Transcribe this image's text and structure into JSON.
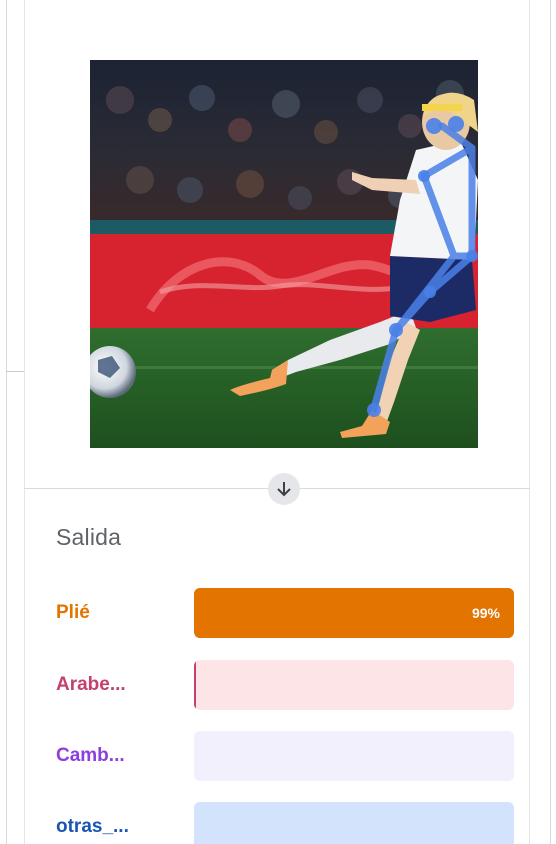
{
  "output": {
    "title": "Salida",
    "rows": [
      {
        "label": "Plié",
        "fraction": 0.99,
        "percent_text": "99%",
        "text_color": "#e37400",
        "fill_color": "#e37400",
        "track_color": "#e37400"
      },
      {
        "label": "Arabe...",
        "fraction": 0.005,
        "percent_text": "",
        "text_color": "#c5416a",
        "fill_color": "#c5416a",
        "track_color": "#fde4e7"
      },
      {
        "label": "Camb...",
        "fraction": 0.0,
        "percent_text": "",
        "text_color": "#8b3fe0",
        "fill_color": "#8b3fe0",
        "track_color": "#f1f0fc"
      },
      {
        "label": "otras_...",
        "fraction": 0.0,
        "percent_text": "",
        "text_color": "#1a54b4",
        "fill_color": "#1a54b4",
        "track_color": "#d3e3fb"
      }
    ]
  },
  "pose_overlay_color": "#4a80e8",
  "icons": {
    "divider_arrow": "arrow-down-icon"
  }
}
